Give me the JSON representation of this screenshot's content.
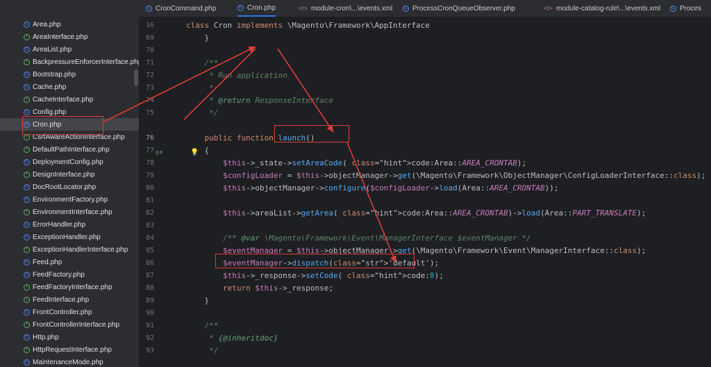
{
  "tree": {
    "items": [
      {
        "name": "Area.php",
        "kind": "c"
      },
      {
        "name": "AreaInterface.php",
        "kind": "i"
      },
      {
        "name": "AreaList.php",
        "kind": "c"
      },
      {
        "name": "BackpressureEnforcerInterface.php",
        "kind": "i"
      },
      {
        "name": "Bootstrap.php",
        "kind": "c"
      },
      {
        "name": "Cache.php",
        "kind": "c"
      },
      {
        "name": "CacheInterface.php",
        "kind": "i"
      },
      {
        "name": "Config.php",
        "kind": "c"
      },
      {
        "name": "Cron.php",
        "kind": "c",
        "selected": true
      },
      {
        "name": "CsrfAwareActionInterface.php",
        "kind": "i"
      },
      {
        "name": "DefaultPathInterface.php",
        "kind": "i"
      },
      {
        "name": "DeploymentConfig.php",
        "kind": "c"
      },
      {
        "name": "DesignInterface.php",
        "kind": "i"
      },
      {
        "name": "DocRootLocator.php",
        "kind": "c"
      },
      {
        "name": "EnvironmentFactory.php",
        "kind": "c"
      },
      {
        "name": "EnvironmentInterface.php",
        "kind": "i"
      },
      {
        "name": "ErrorHandler.php",
        "kind": "c"
      },
      {
        "name": "ExceptionHandler.php",
        "kind": "c"
      },
      {
        "name": "ExceptionHandlerInterface.php",
        "kind": "i"
      },
      {
        "name": "Feed.php",
        "kind": "c"
      },
      {
        "name": "FeedFactory.php",
        "kind": "c"
      },
      {
        "name": "FeedFactoryInterface.php",
        "kind": "i"
      },
      {
        "name": "FeedInterface.php",
        "kind": "i"
      },
      {
        "name": "FrontController.php",
        "kind": "c"
      },
      {
        "name": "FrontControllerInterface.php",
        "kind": "i"
      },
      {
        "name": "Http.php",
        "kind": "c"
      },
      {
        "name": "HttpRequestInterface.php",
        "kind": "i"
      },
      {
        "name": "MaintenanceMode.php",
        "kind": "c"
      }
    ]
  },
  "tabs": [
    {
      "label": "CronCommand.php",
      "type": "php"
    },
    {
      "label": "Cron.php",
      "type": "php",
      "active": true
    },
    {
      "label": "module-cron\\...\\events.xml",
      "type": "xml"
    },
    {
      "label": "ProcessCronQueueObserver.php",
      "type": "php"
    },
    {
      "label": "module-catalog-rule\\...\\events.xml",
      "type": "xml"
    },
    {
      "label": "Proces",
      "type": "php"
    }
  ],
  "editor": {
    "lines": [
      {
        "n": "16",
        "t": "class Cron implements \\Magento\\Framework\\AppInterface"
      },
      {
        "n": "69",
        "t": "    }"
      },
      {
        "n": "70",
        "t": ""
      },
      {
        "n": "71",
        "t": "    /**"
      },
      {
        "n": "72",
        "t": "     * Run application"
      },
      {
        "n": "73",
        "t": "     *"
      },
      {
        "n": "74",
        "t": "     * @return ResponseInterface"
      },
      {
        "n": "75",
        "t": "     */"
      },
      {
        "n": "",
        "t": ""
      },
      {
        "n": "76",
        "t": "    public function launch()"
      },
      {
        "n": "77",
        "t": "    {"
      },
      {
        "n": "78",
        "t": "        $this->_state->setAreaCode( code: Area::AREA_CRONTAB);"
      },
      {
        "n": "79",
        "t": "        $configLoader = $this->objectManager->get(\\Magento\\Framework\\ObjectManager\\ConfigLoaderInterface::class);"
      },
      {
        "n": "80",
        "t": "        $this->objectManager->configure($configLoader->load(Area::AREA_CRONTAB));"
      },
      {
        "n": "81",
        "t": ""
      },
      {
        "n": "82",
        "t": "        $this->areaList->getArea( code: Area::AREA_CRONTAB)->load(Area::PART_TRANSLATE);"
      },
      {
        "n": "83",
        "t": ""
      },
      {
        "n": "84",
        "t": "        /** @var \\Magento\\Framework\\Event\\ManagerInterface $eventManager */"
      },
      {
        "n": "85",
        "t": "        $eventManager = $this->objectManager->get(\\Magento\\Framework\\Event\\ManagerInterface::class);"
      },
      {
        "n": "86",
        "t": "        $eventManager->dispatch('default');"
      },
      {
        "n": "87",
        "t": "        $this->_response->setCode( code: 0);"
      },
      {
        "n": "88",
        "t": "        return $this->_response;"
      },
      {
        "n": "89",
        "t": "    }"
      },
      {
        "n": "90",
        "t": ""
      },
      {
        "n": "91",
        "t": "    /**"
      },
      {
        "n": "92",
        "t": "     * {@inheritdoc}"
      },
      {
        "n": "93",
        "t": "     */"
      }
    ]
  },
  "colors": {
    "highlight": "#e03c3c",
    "accent": "#3574f0"
  }
}
